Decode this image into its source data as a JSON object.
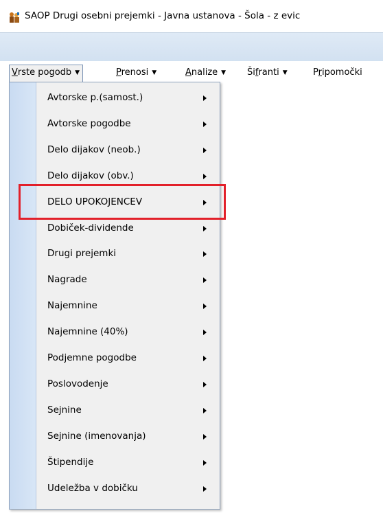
{
  "window": {
    "title": "SAOP Drugi osebni prejemki - Javna ustanova - Šola - z evic",
    "app_icon": "saop-people-icon"
  },
  "menubar": {
    "items": [
      {
        "label": "Vrste pogodb",
        "accel": "V"
      },
      {
        "label": "Prenosi",
        "accel": "P"
      },
      {
        "label": "Analize",
        "accel": "A"
      },
      {
        "label": "Šifranti",
        "accel": "f"
      },
      {
        "label": "Pripomočki",
        "accel": "r"
      }
    ]
  },
  "dropdown": {
    "items": [
      "Avtorske p.(samost.)",
      "Avtorske pogodbe",
      "Delo dijakov (neob.)",
      "Delo dijakov (obv.)",
      "DELO UPOKOJENCEV",
      "Dobiček-dividende",
      "Drugi prejemki",
      "Nagrade",
      "Najemnine",
      "Najemnine (40%)",
      "Podjemne pogodbe",
      "Poslovodenje",
      "Sejnine",
      "Sejnine (imenovanja)",
      "Štipendije",
      "Udeležba v dobičku"
    ],
    "highlighted_item": "DELO UPOKOJENCEV"
  },
  "colors": {
    "highlight_border": "#e2202a",
    "menu_gutter": "#c9dbf2",
    "toolbar_strip": "#d6e4f3"
  }
}
